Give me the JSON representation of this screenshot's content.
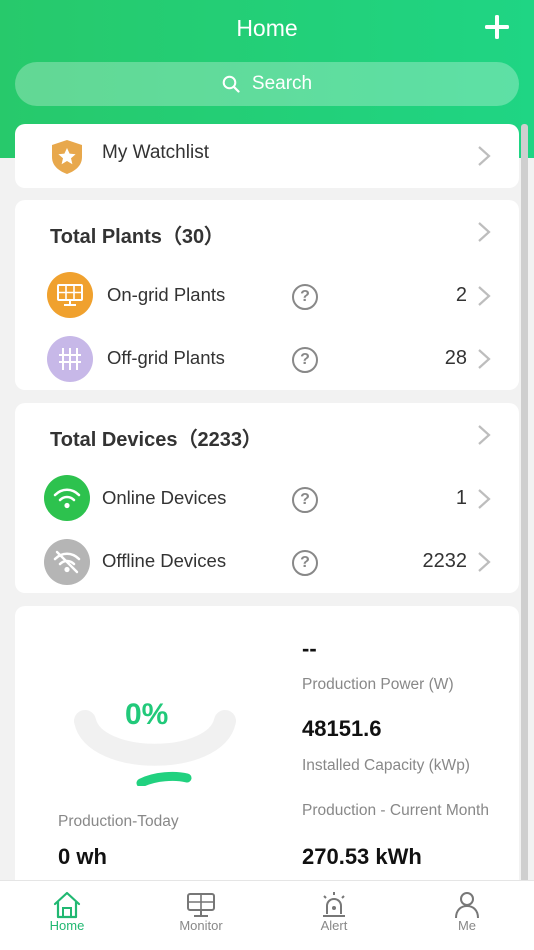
{
  "header": {
    "title": "Home",
    "add_icon": "plus-icon",
    "search_placeholder": "Search",
    "search_icon": "search-icon"
  },
  "watchlist": {
    "label": "My Watchlist",
    "icon": "star-shield-icon"
  },
  "plants": {
    "title": "Total Plants（30）",
    "rows": [
      {
        "label": "On-grid Plants",
        "count": "2",
        "icon": "solar-panel-icon",
        "icon_color": "#f0a12e"
      },
      {
        "label": "Off-grid Plants",
        "count": "28",
        "icon": "pylon-icon",
        "icon_color": "#c7b8e8"
      }
    ]
  },
  "devices": {
    "title": "Total Devices（2233）",
    "rows": [
      {
        "label": "Online Devices",
        "count": "1",
        "icon": "wifi-icon",
        "icon_color": "#2dc24e"
      },
      {
        "label": "Offline Devices",
        "count": "2232",
        "icon": "wifi-off-icon",
        "icon_color": "#b5b5b5"
      }
    ]
  },
  "production": {
    "percent": "0%",
    "percent_value": 0,
    "production_power_value": "--",
    "production_power_label": "Production Power (W)",
    "installed_capacity_value": "48151.6",
    "installed_capacity_label": "Installed Capacity (kWp)",
    "production_today_label": "Production-Today",
    "production_today_value": "0 wh",
    "production_month_label": "Production - Current Month",
    "production_month_value": "270.53 kWh"
  },
  "tabs": [
    {
      "label": "Home",
      "icon": "home-icon",
      "active": true
    },
    {
      "label": "Monitor",
      "icon": "monitor-icon",
      "active": false
    },
    {
      "label": "Alert",
      "icon": "alert-beacon-icon",
      "active": false
    },
    {
      "label": "Me",
      "icon": "person-icon",
      "active": false
    }
  ],
  "colors": {
    "brand_green": "#21c97a",
    "background": "#f2f2f2"
  }
}
